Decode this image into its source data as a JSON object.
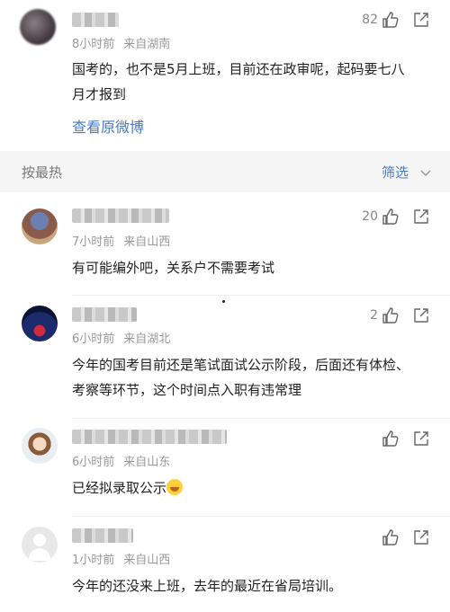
{
  "top_comment": {
    "likes": "82",
    "time": "8小时前",
    "location": "来自湖南",
    "text": "国考的，也不是5月上班，目前还在政审呢，起码要七八月才报到",
    "view_original": "查看原微博"
  },
  "sort_bar": {
    "label": "按最热",
    "filter_label": "筛选"
  },
  "comments": [
    {
      "likes": "20",
      "time": "7小时前",
      "location": "来自山西",
      "text": "有可能编外吧，关系户不需要考试",
      "avatar": "tree-avatar"
    },
    {
      "likes": "2",
      "time": "6小时前",
      "location": "来自湖北",
      "text": "今年的国考目前还是笔试面试公示阶段，后面还有体检、考察等环节，这个时间点入职有违常理",
      "avatar": "night-avatar"
    },
    {
      "likes": "",
      "time": "6小时前",
      "location": "来自山东",
      "text": "已经拟录取公示",
      "avatar": "girl-avatar",
      "emoji": "laugh-cry-emoji"
    },
    {
      "likes": "",
      "time": "1小时前",
      "location": "来自山西",
      "text": "今年的还没来上班，去年的最近在省局培训。",
      "avatar": "default-avatar"
    }
  ],
  "colors": {
    "link": "#4a7bc4",
    "meta": "#999999",
    "sort_bg": "#f5f5f5"
  }
}
